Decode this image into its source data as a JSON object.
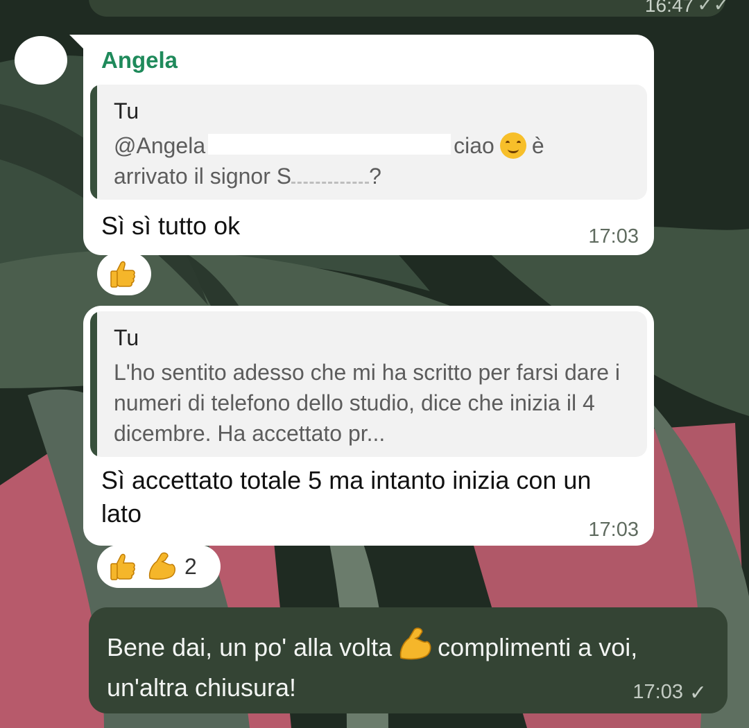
{
  "chat": {
    "top_bubble": {
      "time": "16:47",
      "status": "read"
    },
    "message_1": {
      "sender": "Angela",
      "quote": {
        "author": "Tu",
        "text_before": "@Angela",
        "text_after": "ciao",
        "text_line2": "è",
        "text_line3": "arrivato il signor S",
        "text_end": "?"
      },
      "text": "Sì sì tutto ok",
      "time": "17:03",
      "reactions": [
        {
          "emoji": "thumbs-up",
          "count": ""
        }
      ]
    },
    "message_2": {
      "quote": {
        "author": "Tu",
        "text": "L'ho sentito adesso che mi ha scritto per farsi dare i numeri di telefono dello studio, dice che inizia il 4 dicembre. Ha accettato pr..."
      },
      "text": "Sì accettato totale 5 ma intanto inizia con un lato",
      "time": "17:03",
      "reactions": [
        {
          "emoji": "thumbs-up"
        },
        {
          "emoji": "flexed-biceps"
        }
      ],
      "reaction_count": "2"
    },
    "message_3": {
      "text_before": "Bene dai, un po' alla volta",
      "text_after": "complimenti a voi, un'altra chiusura!",
      "time": "17:03",
      "status_icon": "single-check-icon"
    }
  },
  "colors": {
    "incoming_bubble": "#ffffff",
    "outgoing_bubble": "#344434",
    "sender_name": "#1f8a5b",
    "quote_bar": "#38503c",
    "quote_bg": "#f2f2f2"
  }
}
